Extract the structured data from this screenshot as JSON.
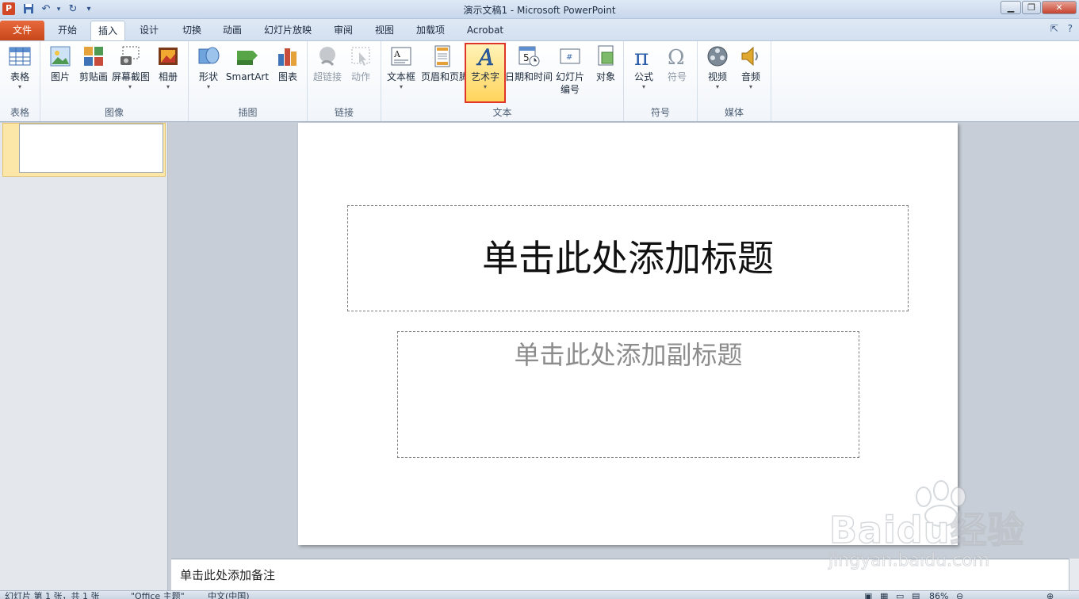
{
  "titlebar": {
    "title": "演示文稿1  -  Microsoft PowerPoint",
    "app_icon": "P",
    "quick_access": [
      "save-icon",
      "undo-icon",
      "redo-icon",
      "customize-icon"
    ],
    "window_buttons": [
      "minimize",
      "maximize",
      "close"
    ]
  },
  "tabs": [
    {
      "label": "文件"
    },
    {
      "label": "开始"
    },
    {
      "label": "插入"
    },
    {
      "label": "设计"
    },
    {
      "label": "切换"
    },
    {
      "label": "动画"
    },
    {
      "label": "幻灯片放映"
    },
    {
      "label": "审阅"
    },
    {
      "label": "视图"
    },
    {
      "label": "加载项"
    },
    {
      "label": "Acrobat"
    }
  ],
  "ribbon": {
    "groups": {
      "table": {
        "label": "表格",
        "buttons": [
          {
            "label": "表格",
            "icon": "table-icon"
          }
        ]
      },
      "images": {
        "label": "图像",
        "buttons": [
          {
            "label": "图片",
            "icon": "picture-icon"
          },
          {
            "label": "剪贴画",
            "icon": "clipart-icon"
          },
          {
            "label": "屏幕截图",
            "icon": "screenshot-icon"
          },
          {
            "label": "相册",
            "icon": "album-icon"
          }
        ]
      },
      "illustrations": {
        "label": "插图",
        "buttons": [
          {
            "label": "形状",
            "icon": "shapes-icon"
          },
          {
            "label": "SmartArt",
            "icon": "smartart-icon"
          },
          {
            "label": "图表",
            "icon": "chart-icon"
          }
        ]
      },
      "links": {
        "label": "链接",
        "buttons": [
          {
            "label": "超链接",
            "icon": "hyperlink-icon"
          },
          {
            "label": "动作",
            "icon": "action-icon"
          }
        ]
      },
      "text": {
        "label": "文本",
        "buttons": [
          {
            "label": "文本框",
            "icon": "textbox-icon"
          },
          {
            "label": "页眉和页脚",
            "icon": "header-footer-icon"
          },
          {
            "label": "艺术字",
            "icon": "wordart-icon"
          },
          {
            "label": "日期和时间",
            "icon": "datetime-icon"
          },
          {
            "label": "幻灯片",
            "label2": "编号",
            "icon": "slide-number-icon"
          },
          {
            "label": "对象",
            "icon": "object-icon"
          }
        ]
      },
      "symbols": {
        "label": "符号",
        "buttons": [
          {
            "label": "公式",
            "icon": "equation-icon"
          },
          {
            "label": "符号",
            "icon": "symbol-icon"
          }
        ]
      },
      "media": {
        "label": "媒体",
        "buttons": [
          {
            "label": "视频",
            "icon": "video-icon"
          },
          {
            "label": "音频",
            "icon": "audio-icon"
          }
        ]
      }
    }
  },
  "slide": {
    "title_placeholder": "单击此处添加标题",
    "subtitle_placeholder": "单击此处添加副标题"
  },
  "notes": {
    "placeholder": "单击此处添加备注"
  },
  "statusbar": {
    "slide_info": "幻灯片 第 1 张，共 1 张",
    "theme": "\"Office 主题\"",
    "language": "中文(中国)",
    "zoom": "86%"
  },
  "watermark": {
    "text": "Baidu经验",
    "url": "jingyan.baidu.com"
  }
}
